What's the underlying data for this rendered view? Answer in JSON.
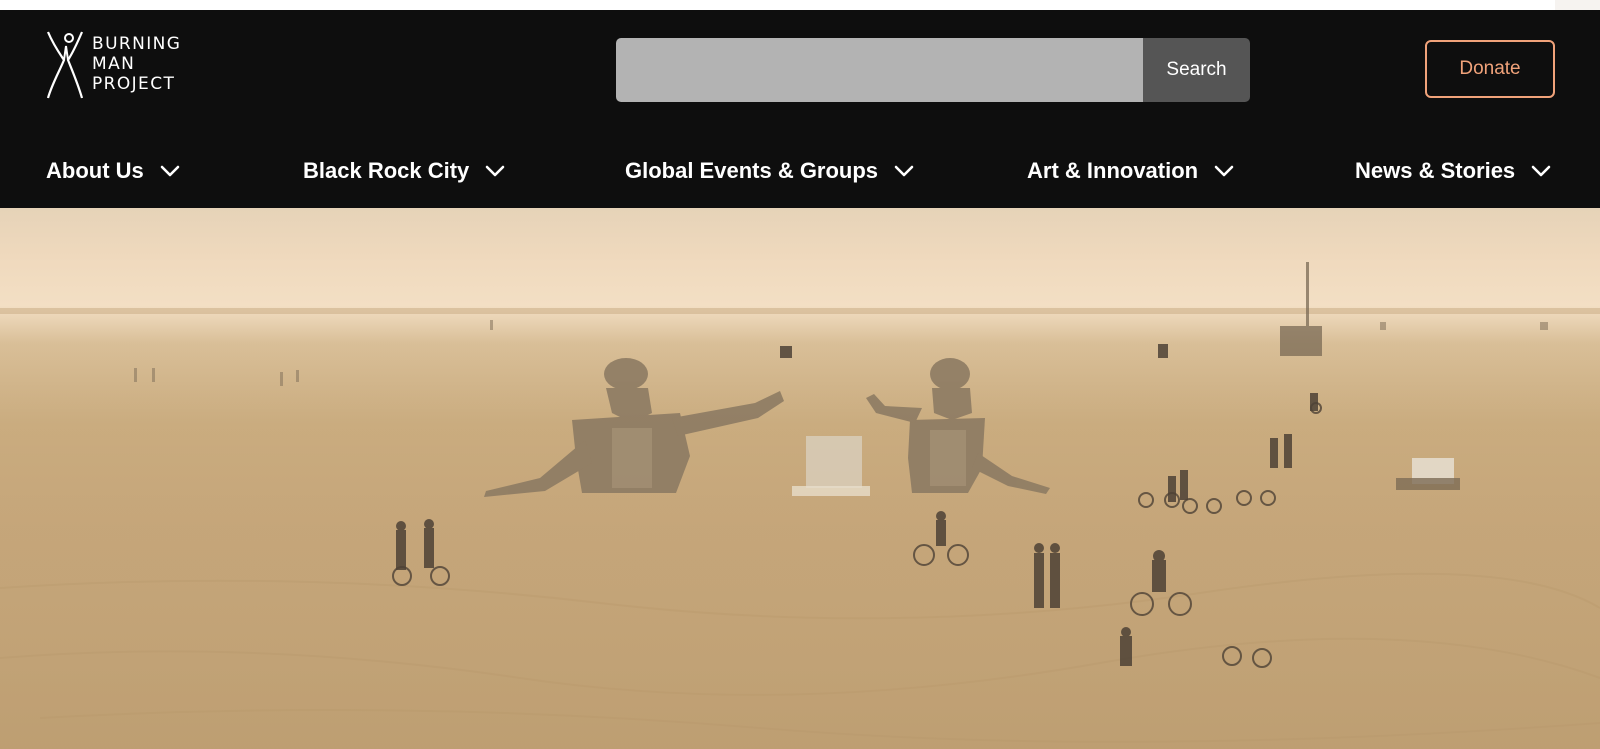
{
  "header": {
    "logo": {
      "line1": "BURNING",
      "line2": "MAN",
      "line3": "PROJECT",
      "icon": "burning-man-figure-icon"
    },
    "search": {
      "value": "",
      "placeholder": "",
      "button_label": "Search"
    },
    "donate_label": "Donate",
    "accent_color": "#f0a27a",
    "background_color": "#0e0e0e"
  },
  "nav": {
    "items": [
      {
        "label": "About Us",
        "icon": "chevron-down-icon"
      },
      {
        "label": "Black Rock City",
        "icon": "chevron-down-icon"
      },
      {
        "label": "Global Events & Groups",
        "icon": "chevron-down-icon"
      },
      {
        "label": "Art & Innovation",
        "icon": "chevron-down-icon"
      },
      {
        "label": "News & Stories",
        "icon": "chevron-down-icon"
      }
    ]
  },
  "hero": {
    "image": "hazy desert playa with two large sculptures and cyclists"
  }
}
